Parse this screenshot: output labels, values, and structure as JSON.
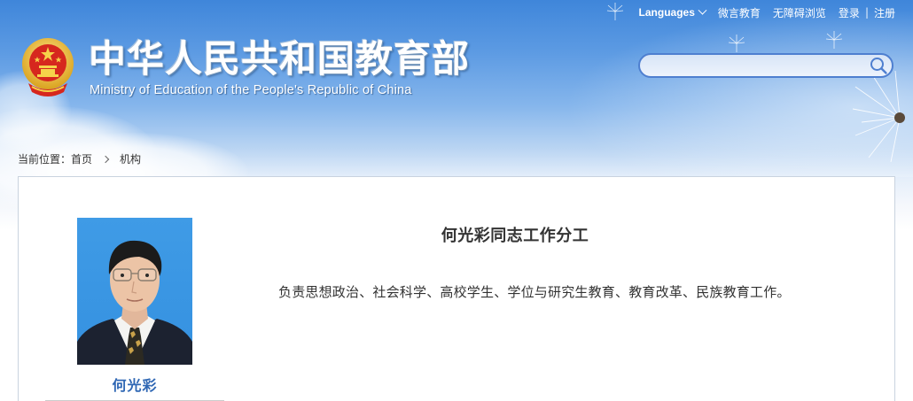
{
  "topbar": {
    "languages_label": "Languages",
    "weiyan_label": "微言教育",
    "accessible_label": "无障碍浏览",
    "login_label": "登录",
    "separator": "|",
    "register_label": "注册"
  },
  "header": {
    "title": "中华人民共和国教育部",
    "subtitle": "Ministry of Education of the People's Republic of China"
  },
  "search": {
    "value": "",
    "placeholder": ""
  },
  "breadcrumb": {
    "prefix": "当前位置：",
    "home": "首页",
    "current": "机构"
  },
  "profile": {
    "name": "何光彩",
    "duty_title": "何光彩同志工作分工",
    "duty_text": "负责思想政治、社会科学、高校学生、学位与研究生教育、教育改革、民族教育工作。"
  },
  "colors": {
    "accent": "#2f67b4",
    "sky_top": "#3f86da",
    "search_border": "#4e7fd0",
    "emblem_red": "#d6271e",
    "emblem_gold": "#f2c744"
  },
  "icons": {
    "search": "search-icon",
    "emblem": "national-emblem-icon",
    "chevron": "chevron-down-icon",
    "breadcrumb_arrow": "chevron-right-icon"
  }
}
